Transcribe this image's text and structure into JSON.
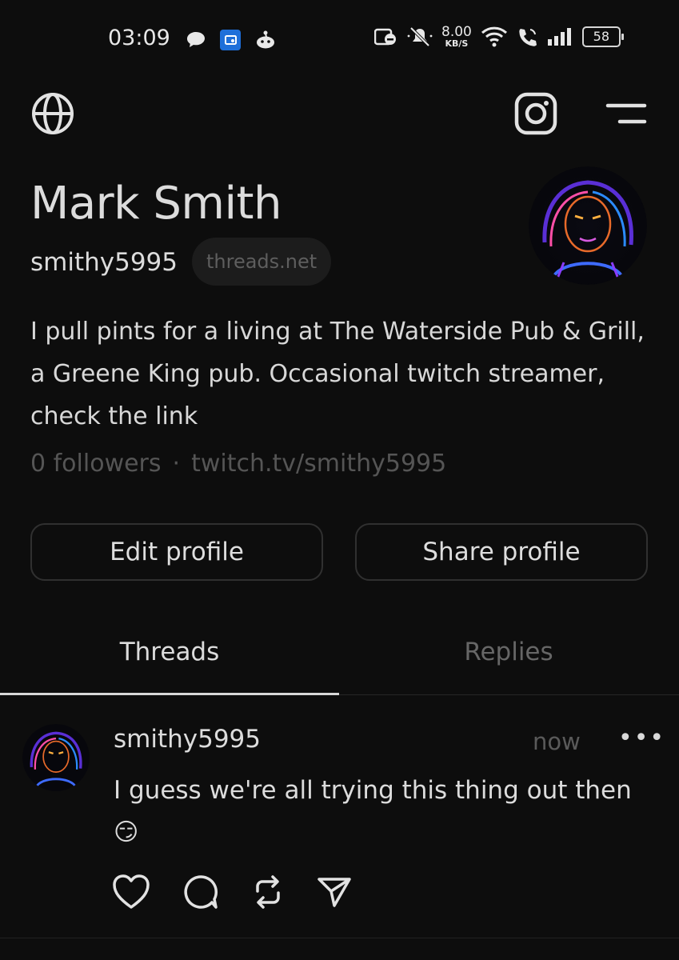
{
  "status_bar": {
    "time": "03:09",
    "net_speed_value": "8.00",
    "net_speed_unit": "KB/S",
    "battery": "58",
    "icons": [
      "chat-bubble-icon",
      "app-notification-icon",
      "reddit-icon",
      "hd-call-icon",
      "muted-bell-icon",
      "wifi-icon",
      "wifi-calling-icon",
      "signal-icon",
      "battery-icon"
    ]
  },
  "top_bar": {
    "left_icon": "globe-icon",
    "right_icons": [
      "instagram-icon",
      "menu-icon"
    ]
  },
  "profile": {
    "name": "Mark Smith",
    "handle": "smithy5995",
    "domain": "threads.net",
    "bio": "I pull pints for a living at The Waterside Pub & Grill, a Greene King pub. Occasional twitch streamer, check the link",
    "followers": "0 followers",
    "separator": "·",
    "link": "twitch.tv/smithy5995"
  },
  "buttons": {
    "edit": "Edit profile",
    "share": "Share profile"
  },
  "tabs": [
    {
      "label": "Threads",
      "active": true
    },
    {
      "label": "Replies",
      "active": false
    }
  ],
  "post": {
    "username": "smithy5995",
    "time": "now",
    "more": "•••",
    "text": "I guess we're all trying this thing out then",
    "emoji": "😏",
    "actions": [
      "heart-icon",
      "comment-icon",
      "repost-icon",
      "send-icon"
    ]
  },
  "colors": {
    "background": "#0d0d0d",
    "text": "#dcdcdc",
    "muted": "#555555",
    "border": "#303030"
  }
}
